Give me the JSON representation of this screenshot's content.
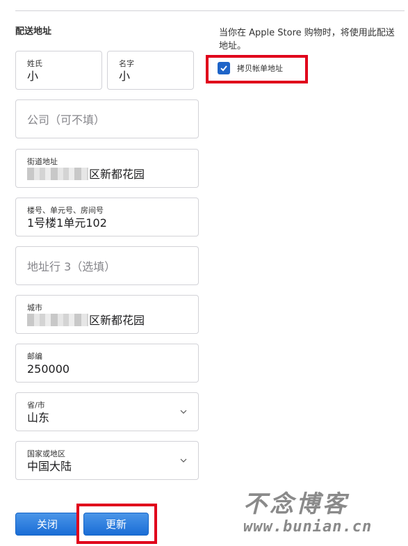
{
  "section_title": "配送地址",
  "note": "当你在 Apple Store 购物时，将使用此配送地址。",
  "copy_billing": {
    "label": "拷贝帐单地址",
    "checked": true
  },
  "fields": {
    "last_name": {
      "label": "姓氏",
      "value": "小"
    },
    "first_name": {
      "label": "名字",
      "value": "小"
    },
    "company": {
      "placeholder": "公司（可不填）"
    },
    "street": {
      "label": "街道地址",
      "value": "区新都花园"
    },
    "unit": {
      "label": "楼号、单元号、房间号",
      "value": "1号楼1单元102"
    },
    "address3": {
      "placeholder": "地址行 3（选填）"
    },
    "city": {
      "label": "城市",
      "value": "区新都花园"
    },
    "postal": {
      "label": "邮编",
      "value": "250000"
    },
    "province": {
      "label": "省/市",
      "value": "山东"
    },
    "country": {
      "label": "国家或地区",
      "value": "中国大陆"
    }
  },
  "buttons": {
    "close": "关闭",
    "update": "更新"
  },
  "watermark": {
    "title": "不念博客",
    "url": "www.bunian.cn"
  },
  "colors": {
    "accent": "#1a6dd6",
    "highlight": "#e0001b",
    "border": "#d2d2d7"
  }
}
